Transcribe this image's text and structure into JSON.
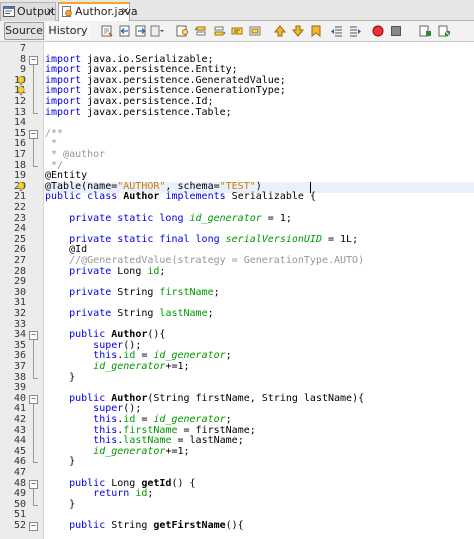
{
  "tabs": [
    {
      "label": "Output",
      "close": "×"
    },
    {
      "label": "Author.java",
      "close": "×"
    }
  ],
  "toolbar": {
    "source_label": "Source",
    "history_label": "History",
    "icons": [
      "last-edit-icon",
      "back-icon",
      "forward-icon",
      "dropdown-icon",
      "find-selection-icon",
      "find-previous-icon",
      "find-next-icon",
      "toggle-highlight-icon",
      "toggle-rect-selection-icon",
      "previous-bookmark-icon",
      "next-bookmark-icon",
      "toggle-bookmark-icon",
      "shift-left-icon",
      "shift-right-icon",
      "start-macro-icon",
      "stop-macro-icon",
      "comment-icon",
      "uncomment-icon"
    ]
  },
  "editor": {
    "line_numbers": [
      "7",
      "8",
      "9",
      "10",
      "11",
      "12",
      "13",
      "14",
      "15",
      "16",
      "17",
      "18",
      "19",
      "20",
      "21",
      "22",
      "23",
      "24",
      "25",
      "26",
      "27",
      "28",
      "29",
      "30",
      "31",
      "32",
      "33",
      "34",
      "35",
      "36",
      "37",
      "38",
      "39",
      "40",
      "41",
      "42",
      "43",
      "44",
      "45",
      "46",
      "47",
      "48",
      "49",
      "50",
      "51",
      "52"
    ],
    "lines": [
      [],
      [
        [
          "kw",
          "import"
        ],
        [
          "n",
          " java.io.Serializable;"
        ]
      ],
      [
        [
          "kw",
          "import"
        ],
        [
          "n",
          " javax.persistence.Entity;"
        ]
      ],
      [
        [
          "kw",
          "import"
        ],
        [
          "n",
          " javax.persistence.GeneratedValue;"
        ]
      ],
      [
        [
          "kw",
          "import"
        ],
        [
          "n",
          " javax.persistence.GenerationType;"
        ]
      ],
      [
        [
          "kw",
          "import"
        ],
        [
          "n",
          " javax.persistence.Id;"
        ]
      ],
      [
        [
          "kw",
          "import"
        ],
        [
          "n",
          " javax.persistence.Table;"
        ]
      ],
      [],
      [
        [
          "cm",
          "/**"
        ]
      ],
      [
        [
          "cm",
          " *"
        ]
      ],
      [
        [
          "cm",
          " * @author"
        ]
      ],
      [
        [
          "cm",
          " */"
        ]
      ],
      [
        [
          "n",
          "@Entity"
        ]
      ],
      [
        [
          "n",
          "@Table(name="
        ],
        [
          "str",
          "\"AUTHOR\""
        ],
        [
          "n",
          ", schema="
        ],
        [
          "str",
          "\"TEST\""
        ],
        [
          "n",
          ")"
        ]
      ],
      [
        [
          "kw",
          "public class"
        ],
        [
          "n",
          " "
        ],
        [
          "b",
          "Author"
        ],
        [
          "n",
          " "
        ],
        [
          "kw",
          "implements"
        ],
        [
          "n",
          " Serializable {"
        ]
      ],
      [],
      [
        [
          "n",
          "    "
        ],
        [
          "kw",
          "private static long"
        ],
        [
          "n",
          " "
        ],
        [
          "fi",
          "id_generator"
        ],
        [
          "n",
          " = 1;"
        ]
      ],
      [],
      [
        [
          "n",
          "    "
        ],
        [
          "kw",
          "private static final long"
        ],
        [
          "n",
          " "
        ],
        [
          "fi",
          "serialVersionUID"
        ],
        [
          "n",
          " = 1L;"
        ]
      ],
      [
        [
          "n",
          "    @Id"
        ]
      ],
      [
        [
          "n",
          "    "
        ],
        [
          "cm",
          "//@GeneratedValue(strategy = GenerationType.AUTO)"
        ]
      ],
      [
        [
          "n",
          "    "
        ],
        [
          "kw",
          "private"
        ],
        [
          "n",
          " Long "
        ],
        [
          "f",
          "id"
        ],
        [
          "n",
          ";"
        ]
      ],
      [],
      [
        [
          "n",
          "    "
        ],
        [
          "kw",
          "private"
        ],
        [
          "n",
          " String "
        ],
        [
          "f",
          "firstName"
        ],
        [
          "n",
          ";"
        ]
      ],
      [],
      [
        [
          "n",
          "    "
        ],
        [
          "kw",
          "private"
        ],
        [
          "n",
          " String "
        ],
        [
          "f",
          "lastName"
        ],
        [
          "n",
          ";"
        ]
      ],
      [],
      [
        [
          "n",
          "    "
        ],
        [
          "kw",
          "public"
        ],
        [
          "n",
          " "
        ],
        [
          "b",
          "Author"
        ],
        [
          "n",
          "(){"
        ]
      ],
      [
        [
          "n",
          "        "
        ],
        [
          "kw",
          "super"
        ],
        [
          "n",
          "();"
        ]
      ],
      [
        [
          "n",
          "        "
        ],
        [
          "kw",
          "this"
        ],
        [
          "n",
          "."
        ],
        [
          "f",
          "id"
        ],
        [
          "n",
          " = "
        ],
        [
          "fi",
          "id_generator"
        ],
        [
          "n",
          ";"
        ]
      ],
      [
        [
          "n",
          "        "
        ],
        [
          "fi",
          "id_generator"
        ],
        [
          "n",
          "+=1;"
        ]
      ],
      [
        [
          "n",
          "    }"
        ]
      ],
      [],
      [
        [
          "n",
          "    "
        ],
        [
          "kw",
          "public"
        ],
        [
          "n",
          " "
        ],
        [
          "b",
          "Author"
        ],
        [
          "n",
          "(String firstName, String lastName){"
        ]
      ],
      [
        [
          "n",
          "        "
        ],
        [
          "kw",
          "super"
        ],
        [
          "n",
          "();"
        ]
      ],
      [
        [
          "n",
          "        "
        ],
        [
          "kw",
          "this"
        ],
        [
          "n",
          "."
        ],
        [
          "f",
          "id"
        ],
        [
          "n",
          " = "
        ],
        [
          "fi",
          "id_generator"
        ],
        [
          "n",
          ";"
        ]
      ],
      [
        [
          "n",
          "        "
        ],
        [
          "kw",
          "this"
        ],
        [
          "n",
          "."
        ],
        [
          "f",
          "firstName"
        ],
        [
          "n",
          " = firstName;"
        ]
      ],
      [
        [
          "n",
          "        "
        ],
        [
          "kw",
          "this"
        ],
        [
          "n",
          "."
        ],
        [
          "f",
          "lastName"
        ],
        [
          "n",
          " = lastName;"
        ]
      ],
      [
        [
          "n",
          "        "
        ],
        [
          "fi",
          "id_generator"
        ],
        [
          "n",
          "+=1;"
        ]
      ],
      [
        [
          "n",
          "    }"
        ]
      ],
      [],
      [
        [
          "n",
          "    "
        ],
        [
          "kw",
          "public"
        ],
        [
          "n",
          " Long "
        ],
        [
          "b",
          "getId"
        ],
        [
          "n",
          "() {"
        ]
      ],
      [
        [
          "n",
          "        "
        ],
        [
          "kw",
          "return"
        ],
        [
          "n",
          " "
        ],
        [
          "f",
          "id"
        ],
        [
          "n",
          ";"
        ]
      ],
      [
        [
          "n",
          "    }"
        ]
      ],
      [],
      [
        [
          "n",
          "    "
        ],
        [
          "kw",
          "public"
        ],
        [
          "n",
          " String "
        ],
        [
          "b",
          "getFirstName"
        ],
        [
          "n",
          "(){"
        ]
      ]
    ]
  },
  "colors": {
    "keyword": "#0000e6",
    "string": "#ce7b00",
    "field": "#009900",
    "comment": "#969696",
    "current_line": "#eaf0fb"
  }
}
